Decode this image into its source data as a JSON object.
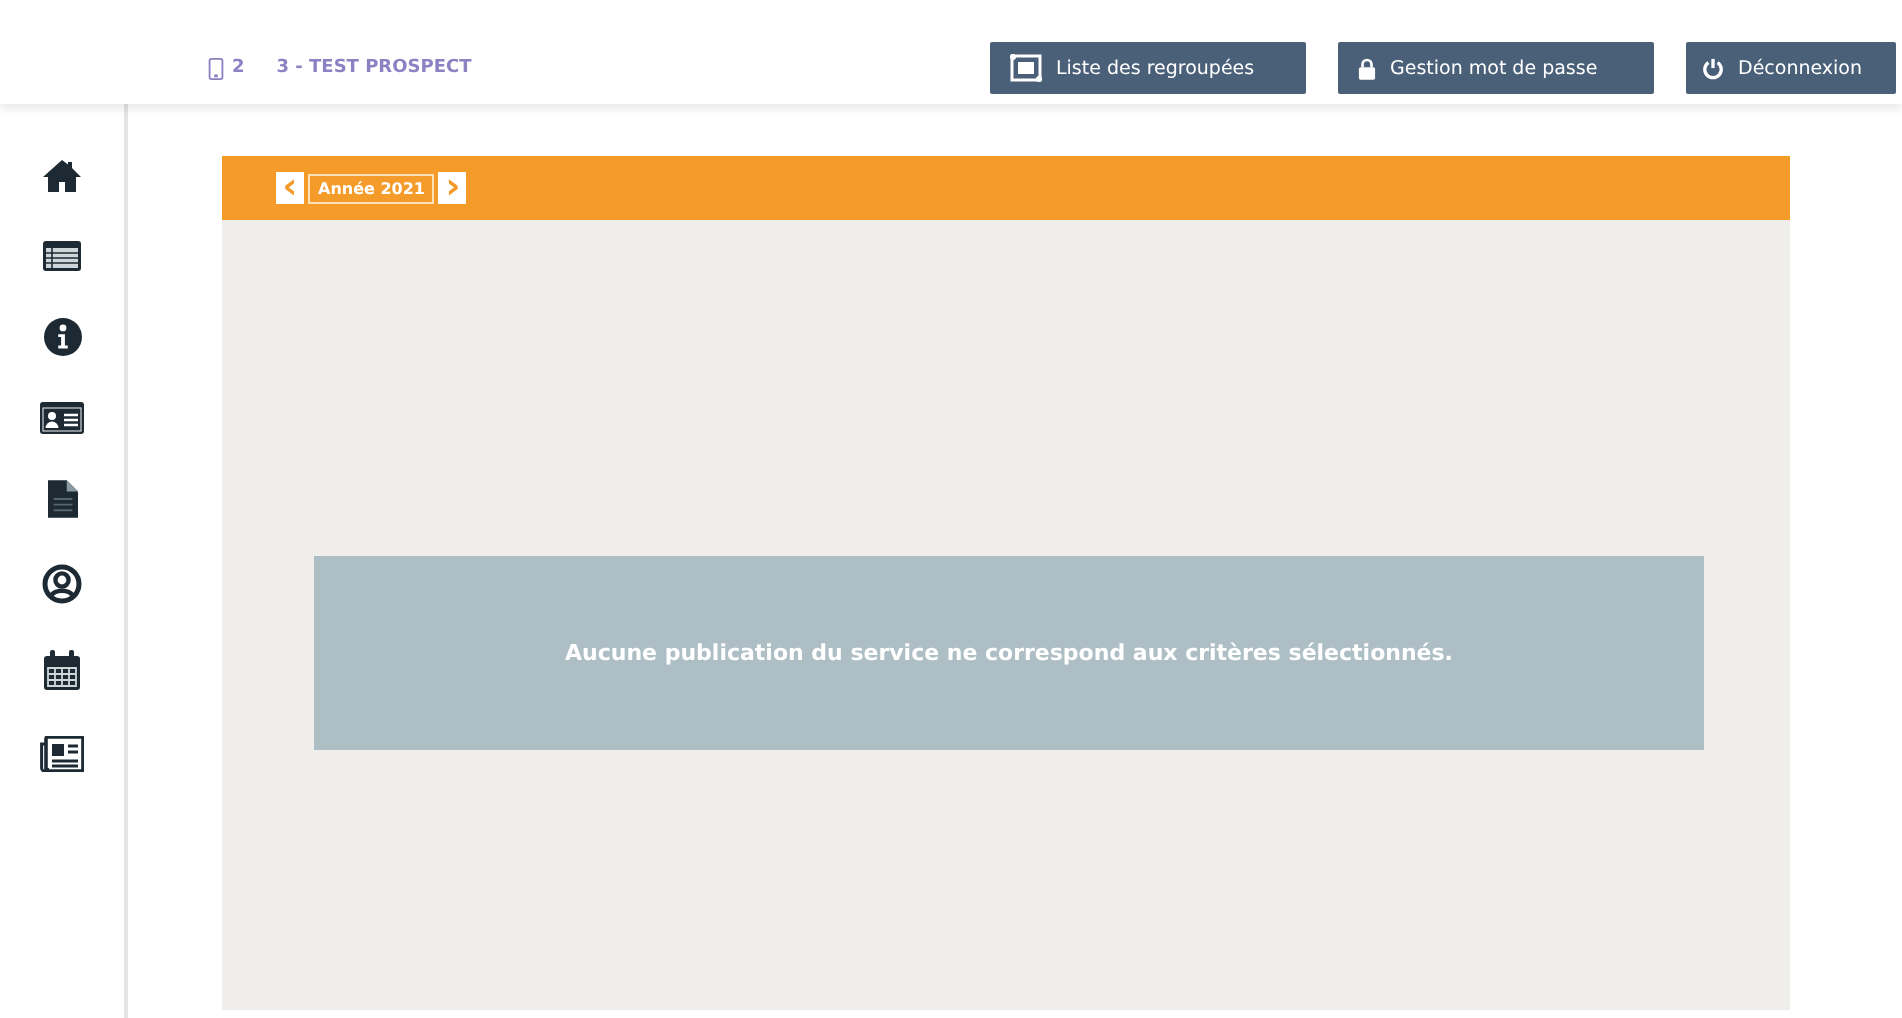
{
  "header": {
    "account_code": "2",
    "account_name": "3 - TEST PROSPECT"
  },
  "buttons": [
    {
      "kind": "group",
      "label": "Liste des regroupées"
    },
    {
      "kind": "lock",
      "label": "Gestion mot de passe"
    },
    {
      "kind": "power",
      "label": "Déconnexion"
    }
  ],
  "sidebar": {
    "items": [
      {
        "kind": "home"
      },
      {
        "kind": "list"
      },
      {
        "kind": "info"
      },
      {
        "kind": "card"
      },
      {
        "kind": "file"
      },
      {
        "kind": "user"
      },
      {
        "kind": "calendar"
      },
      {
        "kind": "news"
      }
    ]
  },
  "year_nav": {
    "prev": "‹",
    "label": "Année 2021",
    "next": "›"
  },
  "message": "Aucune publication du service ne correspond aux critères sélectionnés."
}
